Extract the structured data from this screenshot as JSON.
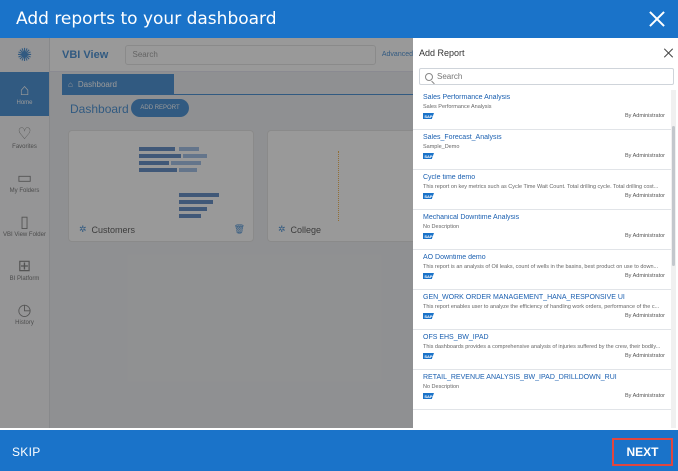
{
  "dialog": {
    "title": "Add reports to your dashboard",
    "skip_label": "SKIP",
    "next_label": "NEXT"
  },
  "background_app": {
    "brand": "VBI View",
    "search_placeholder": "Search",
    "advanced_link": "Advanced",
    "nav": [
      {
        "label": "Home",
        "icon": "home-icon",
        "active": true
      },
      {
        "label": "Favorites",
        "icon": "heart-icon"
      },
      {
        "label": "My Folders",
        "icon": "folder-icon"
      },
      {
        "label": "VBI View Folder",
        "icon": "folder-icon"
      },
      {
        "label": "BI Platform",
        "icon": "hierarchy-icon"
      },
      {
        "label": "History",
        "icon": "clock-icon"
      }
    ],
    "breadcrumb": "Dashboard",
    "dashboard_title": "Dashboard",
    "add_report_button": "ADD REPORT",
    "cards": [
      {
        "name": "Customers"
      },
      {
        "name": "College"
      }
    ]
  },
  "panel": {
    "title": "Add Report",
    "search_placeholder": "Search",
    "reports": [
      {
        "title": "Sales Performance Analysis",
        "description": "Sales Performance Analysis",
        "author": "By Administrator"
      },
      {
        "title": "Sales_Forecast_Analysis",
        "description": "Sample_Demo",
        "author": "By Administrator"
      },
      {
        "title": "Cycle time demo",
        "description": "This report on key metrics such as Cycle Time Wait Count. Total drilling cycle. Total drilling cost...",
        "author": "By Administrator"
      },
      {
        "title": "Mechanical Downtime Analysis",
        "description": "No Description",
        "author": "By Administrator"
      },
      {
        "title": "AO Downtime demo",
        "description": "This report is an analysis of Oil leaks, count of wells in the basins, best product on use to down...",
        "author": "By Administrator"
      },
      {
        "title": "GEN_WORK ORDER MANAGEMENT_HANA_RESPONSIVE UI",
        "description": "This report enables user to analyze the efficiency of handling work orders, performance of the c...",
        "author": "By Administrator"
      },
      {
        "title": "OFS EHS_BW_IPAD",
        "description": "This dashboards provides a comprehensive analysis of injuries suffered by the crew, their bodily...",
        "author": "By Administrator"
      },
      {
        "title": "RETAIL_REVENUE ANALYSIS_BW_IPAD_DRILLDOWN_RUI",
        "description": "No Description",
        "author": "By Administrator"
      }
    ]
  },
  "colors": {
    "primary": "#1a73c9",
    "next_highlight": "#e0463f"
  }
}
